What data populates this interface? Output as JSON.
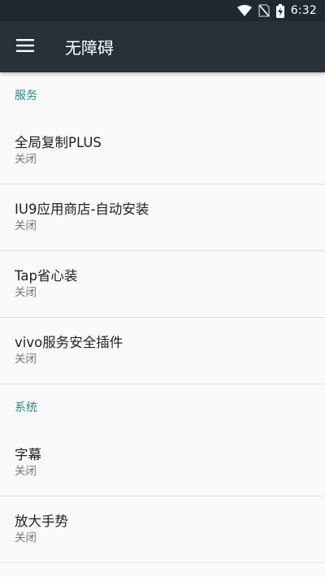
{
  "status_bar": {
    "time": "6:32",
    "icons": [
      "wifi-icon",
      "no-sim-icon",
      "battery-charging-icon"
    ]
  },
  "app_bar": {
    "title": "无障碍",
    "menu_icon": "menu-icon"
  },
  "sections": [
    {
      "header": "服务",
      "items": [
        {
          "title": "全局复制PLUS",
          "summary": "关闭"
        },
        {
          "title": "IU9应用商店-自动安装",
          "summary": "关闭"
        },
        {
          "title": "Tap省心装",
          "summary": "关闭"
        },
        {
          "title": "vivo服务安全插件",
          "summary": "关闭"
        }
      ]
    },
    {
      "header": "系统",
      "items": [
        {
          "title": "字幕",
          "summary": "关闭"
        },
        {
          "title": "放大手势",
          "summary": "关闭"
        }
      ]
    }
  ],
  "colors": {
    "app_bar": "#263238",
    "status_bar": "#1f2a30",
    "accent": "#26897f",
    "background": "#fafafa"
  }
}
